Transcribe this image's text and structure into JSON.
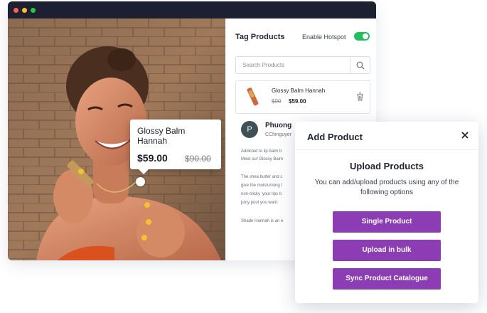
{
  "window": {
    "controls": [
      "close",
      "minimize",
      "maximize"
    ]
  },
  "tooltip": {
    "name": "Glossy Balm Hannah",
    "price": "$59.00",
    "original_price": "$90.00"
  },
  "panel": {
    "title": "Tag Products",
    "hotspot_label": "Enable Hotspot",
    "hotspot_enabled": true,
    "search_placeholder": "Search Products",
    "product": {
      "name": "Glossy Balm Hannah",
      "original_price": "$90",
      "price": "$59.00"
    },
    "comment": {
      "avatar_letter": "P",
      "name": "Phuong",
      "handle": "CChinguyer",
      "lines": [
        "Addicted to lip balm b",
        "Meet our Glossy Balm",
        "",
        "The shea butter and c",
        "give the moisturising l",
        "non-sticky 'your lips b",
        "juicy pout you want.",
        "",
        "Shade Hannah is an e"
      ]
    }
  },
  "modal": {
    "title": "Add Product",
    "upload_title": "Upload Products",
    "upload_description": "You can add/upload products using any of the following options",
    "buttons": [
      "Single Product",
      "Upload in bulk",
      "Sync Product Catalogue"
    ]
  },
  "colors": {
    "accent_purple": "#8d3db4",
    "toggle_green": "#22c05a",
    "titlebar": "#1c2030"
  }
}
